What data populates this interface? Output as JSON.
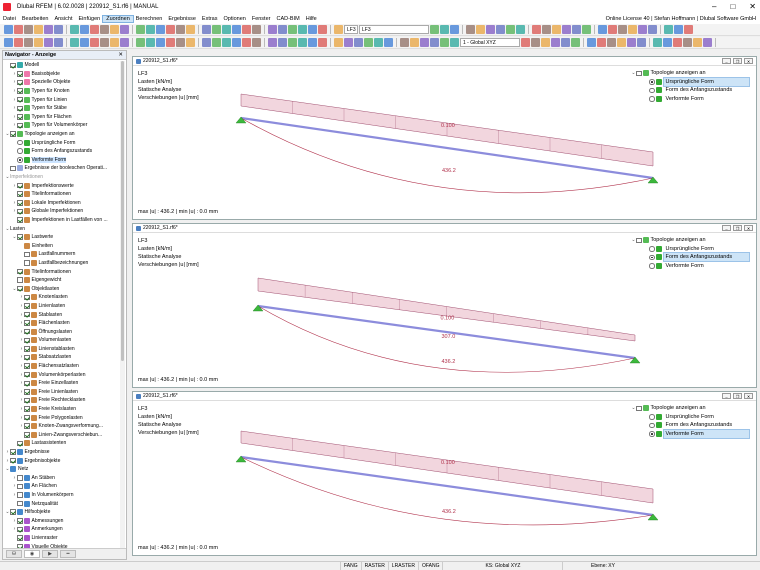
{
  "window": {
    "title": "Dlubal RFEM | 6.02.0028 | 220912_S1.rf6 | MANUAL",
    "license": "Online License 40 | Stefan Hoffmann | Dlubal Software GmbH"
  },
  "menu": [
    "Datei",
    "Bearbeiten",
    "Ansicht",
    "Einfügen",
    "Zuordnen",
    "Berechnen",
    "Ergebnisse",
    "Extras",
    "Optionen",
    "Fenster",
    "CAD-BIM",
    "Hilfe"
  ],
  "toolbar": {
    "load_case_tag": "LF3",
    "load_case_name": "LF3",
    "coord_system": "1 - Global XYZ"
  },
  "navigator": {
    "title": "Navigator - Anzeige",
    "items": [
      {
        "d": 0,
        "t": "",
        "cb": "on",
        "label": "Modell",
        "ic": "#3aa"
      },
      {
        "d": 1,
        "t": "›",
        "cb": "on",
        "label": "Basisobjekte",
        "ic": "#e7a"
      },
      {
        "d": 1,
        "t": "›",
        "cb": "on",
        "label": "Spezielle Objekte",
        "ic": "#e7a"
      },
      {
        "d": 1,
        "t": "›",
        "cb": "on",
        "label": "Typen für Knoten",
        "ic": "#5b5"
      },
      {
        "d": 1,
        "t": "›",
        "cb": "on",
        "label": "Typen für Linien",
        "ic": "#5b5"
      },
      {
        "d": 1,
        "t": "›",
        "cb": "on",
        "label": "Typen für Stäbe",
        "ic": "#5b5"
      },
      {
        "d": 1,
        "t": "›",
        "cb": "on",
        "label": "Typen für Flächen",
        "ic": "#5b5"
      },
      {
        "d": 1,
        "t": "›",
        "cb": "on",
        "label": "Typen für Volumenkörper",
        "ic": "#5b5"
      },
      {
        "d": 0,
        "t": "⌄",
        "cb": "on",
        "label": "Topologie anzeigen an",
        "ic": "#5b5"
      },
      {
        "d": 1,
        "t": "",
        "rb": "off",
        "label": "Ursprüngliche Form",
        "ic": "#3a3"
      },
      {
        "d": 1,
        "t": "",
        "rb": "off",
        "label": "Form des Anfangszustands",
        "ic": "#3a3"
      },
      {
        "d": 1,
        "t": "",
        "rb": "on",
        "label": "Verformte Form",
        "ic": "#3a3",
        "sel": true
      },
      {
        "d": 0,
        "t": "",
        "cb": "off",
        "label": "Ergebnisse der booleschen Operati...",
        "ic": "#9ad"
      },
      {
        "d": 0,
        "t": "⌄",
        "cb": "",
        "label": "Imperfektionen",
        "ic": "",
        "dim": true
      },
      {
        "d": 1,
        "t": "›",
        "cb": "on",
        "label": "Imperfektionswerte",
        "ic": "#c84"
      },
      {
        "d": 1,
        "t": "",
        "cb": "on",
        "label": "Titelinformationen",
        "ic": "#c84"
      },
      {
        "d": 1,
        "t": "›",
        "cb": "on",
        "label": "Lokale Imperfektionen",
        "ic": "#c84"
      },
      {
        "d": 1,
        "t": "›",
        "cb": "on",
        "label": "Globale Imperfektionen",
        "ic": "#c84"
      },
      {
        "d": 1,
        "t": "",
        "cb": "on",
        "label": "Imperfektionen in Lastfällen von ...",
        "ic": "#c84"
      },
      {
        "d": 0,
        "t": "⌄",
        "cb": "",
        "label": "Lasten",
        "ic": ""
      },
      {
        "d": 1,
        "t": "⌄",
        "cb": "on",
        "label": "Lastwerte",
        "ic": "#c84"
      },
      {
        "d": 2,
        "t": "",
        "cb": "",
        "label": "Einheiten",
        "ic": "#c84"
      },
      {
        "d": 2,
        "t": "",
        "cb": "off",
        "label": "Lastfallnummern",
        "ic": "#c84"
      },
      {
        "d": 2,
        "t": "",
        "cb": "off",
        "label": "Lastfallbezeichnungen",
        "ic": "#c84"
      },
      {
        "d": 1,
        "t": "",
        "cb": "on",
        "label": "Titelinformationen",
        "ic": "#c84"
      },
      {
        "d": 1,
        "t": "",
        "cb": "off",
        "label": "Eigengewicht",
        "ic": "#c84"
      },
      {
        "d": 1,
        "t": "⌄",
        "cb": "on",
        "label": "Objektlasten",
        "ic": "#c84"
      },
      {
        "d": 2,
        "t": "›",
        "cb": "on",
        "label": "Knotenlasten",
        "ic": "#c84"
      },
      {
        "d": 2,
        "t": "›",
        "cb": "on",
        "label": "Linienlasten",
        "ic": "#c84"
      },
      {
        "d": 2,
        "t": "›",
        "cb": "on",
        "label": "Stablasten",
        "ic": "#c84"
      },
      {
        "d": 2,
        "t": "›",
        "cb": "on",
        "label": "Flächenlasten",
        "ic": "#c84"
      },
      {
        "d": 2,
        "t": "›",
        "cb": "on",
        "label": "Öffnungslasten",
        "ic": "#c84"
      },
      {
        "d": 2,
        "t": "›",
        "cb": "on",
        "label": "Volumenlasten",
        "ic": "#c84"
      },
      {
        "d": 2,
        "t": "›",
        "cb": "on",
        "label": "Linienstablasten",
        "ic": "#c84"
      },
      {
        "d": 2,
        "t": "›",
        "cb": "on",
        "label": "Stabsatzlasten",
        "ic": "#c84"
      },
      {
        "d": 2,
        "t": "›",
        "cb": "on",
        "label": "Flächensatzlasten",
        "ic": "#c84"
      },
      {
        "d": 2,
        "t": "›",
        "cb": "on",
        "label": "Volumenkörperlasten",
        "ic": "#c84"
      },
      {
        "d": 2,
        "t": "›",
        "cb": "on",
        "label": "Freie Einzellasten",
        "ic": "#c84"
      },
      {
        "d": 2,
        "t": "›",
        "cb": "on",
        "label": "Freie Linienlasten",
        "ic": "#c84"
      },
      {
        "d": 2,
        "t": "›",
        "cb": "on",
        "label": "Freie Rechtecklasten",
        "ic": "#c84"
      },
      {
        "d": 2,
        "t": "›",
        "cb": "on",
        "label": "Freie Kreislasten",
        "ic": "#c84"
      },
      {
        "d": 2,
        "t": "›",
        "cb": "on",
        "label": "Freie Polygonlasten",
        "ic": "#c84"
      },
      {
        "d": 2,
        "t": "›",
        "cb": "on",
        "label": "Knoten-Zwangsverformung...",
        "ic": "#c84"
      },
      {
        "d": 2,
        "t": "",
        "cb": "on",
        "label": "Linien-Zwangsverschiebun...",
        "ic": "#c84"
      },
      {
        "d": 1,
        "t": "",
        "cb": "on",
        "label": "Lastassistenten",
        "ic": "#c84"
      },
      {
        "d": 0,
        "t": "›",
        "cb": "on",
        "label": "Ergebnisse",
        "ic": "#48c"
      },
      {
        "d": 0,
        "t": "›",
        "cb": "on",
        "label": "Ergebnisobjekte",
        "ic": "#48c"
      },
      {
        "d": 0,
        "t": "⌄",
        "cb": "",
        "label": "Netz",
        "ic": "#48c"
      },
      {
        "d": 1,
        "t": "›",
        "cb": "off",
        "label": "An Stäben",
        "ic": "#48c"
      },
      {
        "d": 1,
        "t": "›",
        "cb": "off",
        "label": "An Flächen",
        "ic": "#48c"
      },
      {
        "d": 1,
        "t": "›",
        "cb": "off",
        "label": "In Volumenkörpern",
        "ic": "#48c"
      },
      {
        "d": 1,
        "t": "",
        "cb": "off",
        "label": "Netzqualität",
        "ic": "#48c"
      },
      {
        "d": 0,
        "t": "⌄",
        "cb": "on",
        "label": "Hilfsobjekte",
        "ic": "#48c"
      },
      {
        "d": 1,
        "t": "›",
        "cb": "on",
        "label": "Abmessungen",
        "ic": "#a5c"
      },
      {
        "d": 1,
        "t": "›",
        "cb": "on",
        "label": "Anmerkungen",
        "ic": "#a5c"
      },
      {
        "d": 1,
        "t": "",
        "cb": "on",
        "label": "Linienraster",
        "ic": "#a5c"
      },
      {
        "d": 1,
        "t": "",
        "cb": "on",
        "label": "Visuelle Objekte",
        "ic": "#a5c"
      }
    ]
  },
  "panes": [
    {
      "title": "220912_S1.rf6*",
      "lines": [
        "LF3",
        "Lasten [kN/m]",
        "Statische Analyse",
        "Verschiebungen |u| [mm]"
      ],
      "topo_title": "Topologie anzeigen an",
      "options": [
        "Ursprüngliche Form",
        "Form des Anfangszustands",
        "Verformte Form"
      ],
      "selected": 0,
      "label_load": "0.100",
      "label_max": "436.2",
      "label_mid": "",
      "footer": "max |u| : 436.2 | min |u| : 0.0 mm"
    },
    {
      "title": "220912_S1.rf6*",
      "lines": [
        "LF3",
        "Lasten [kN/m]",
        "Statische Analyse",
        "Verschiebungen |u| [mm]"
      ],
      "topo_title": "Topologie anzeigen an",
      "options": [
        "Ursprüngliche Form",
        "Form des Anfangszustands",
        "Verformte Form"
      ],
      "selected": 1,
      "label_load": "0.100",
      "label_max": "436.2",
      "label_mid": "307.0",
      "footer": "max |u| : 436.2 | min |u| : 0.0 mm"
    },
    {
      "title": "220912_S1.rf6*",
      "lines": [
        "LF3",
        "Lasten [kN/m]",
        "Statische Analyse",
        "Verschiebungen |u| [mm]"
      ],
      "topo_title": "Topologie anzeigen an",
      "options": [
        "Ursprüngliche Form",
        "Form des Anfangszustands",
        "Verformte Form"
      ],
      "selected": 2,
      "label_load": "0.100",
      "label_max": "436.2",
      "label_mid": "",
      "footer": "max |u| : 436.2 | min |u| : 0.0 mm"
    }
  ],
  "statusbar": {
    "toggles": [
      "FANG",
      "RASTER",
      "LRASTER",
      "OFANG"
    ],
    "cs": "KS: Global XYZ",
    "plane": "Ebene: XY"
  },
  "colors": {
    "accent": "#2a6bbf",
    "load_fill": "#f2d6de",
    "load_stroke": "#a05070",
    "beam": "#8c8cdc",
    "deform": "#b0304a",
    "support": "#3cb83c"
  }
}
